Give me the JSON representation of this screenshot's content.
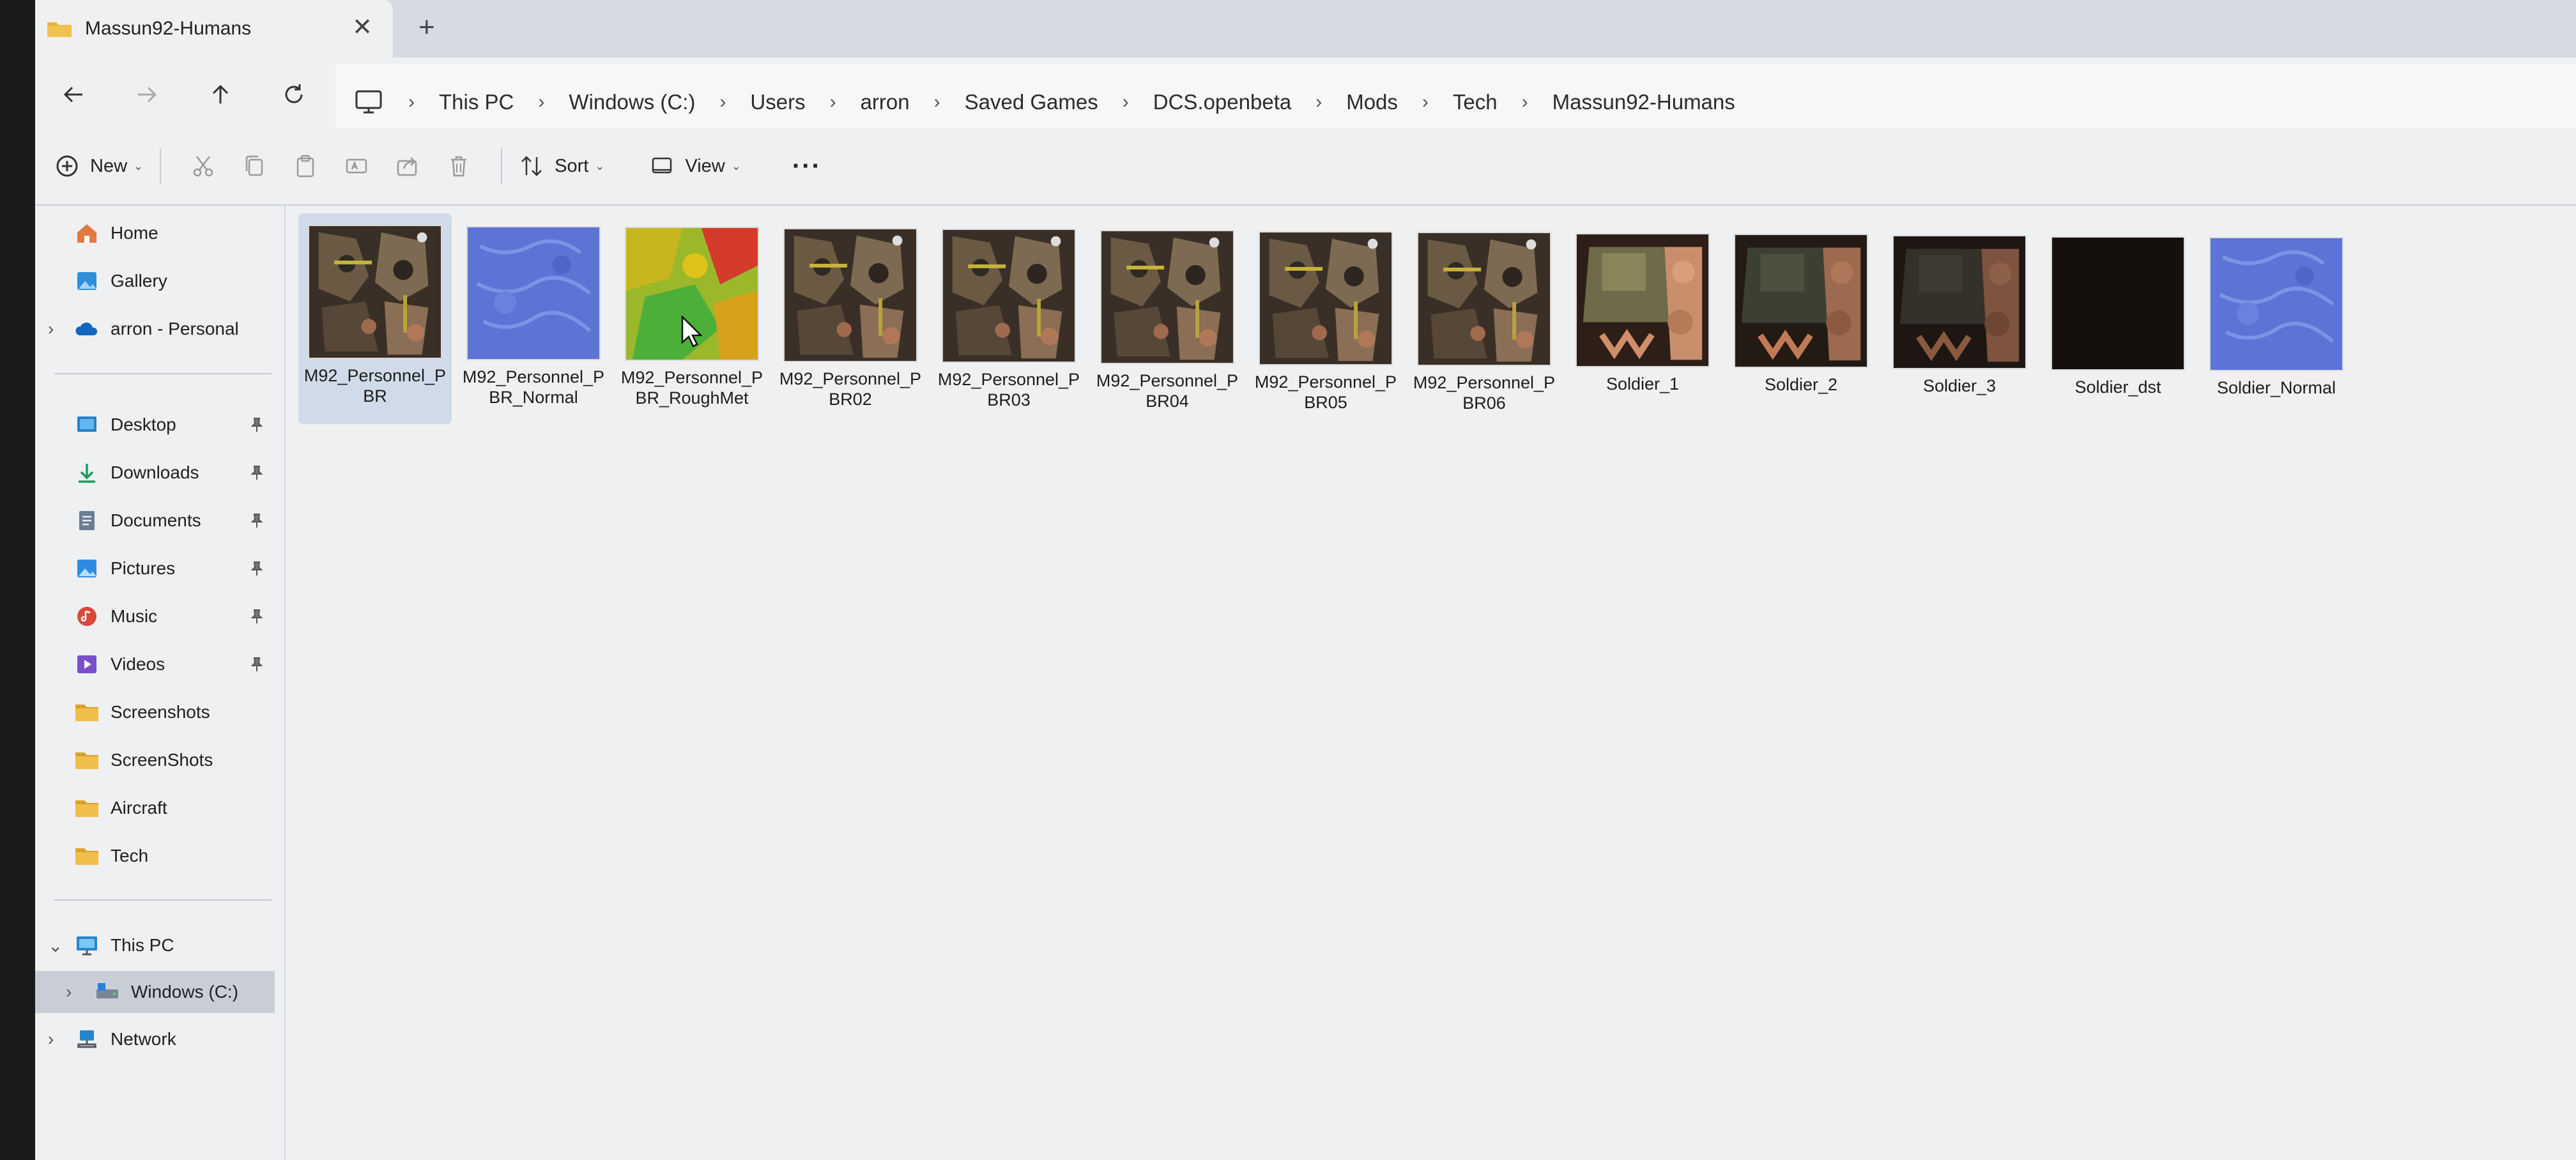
{
  "window": {
    "tab_title": "Massun92-Humans",
    "close_glyph": "✕",
    "new_tab_glyph": "+"
  },
  "address_bar": {
    "breadcrumbs": [
      "This PC",
      "Windows (C:)",
      "Users",
      "arron",
      "Saved Games",
      "DCS.openbeta",
      "Mods",
      "Tech",
      "Massun92-Humans"
    ],
    "separator": "›"
  },
  "toolbar": {
    "new_label": "New",
    "sort_label": "Sort",
    "view_label": "View",
    "more_label": "···",
    "caret": "⌄"
  },
  "sidebar": {
    "quick": [
      {
        "label": "Home",
        "icon": "home-icon"
      },
      {
        "label": "Gallery",
        "icon": "gallery-icon"
      },
      {
        "label": "arron - Personal",
        "icon": "onedrive-icon"
      }
    ],
    "pinned": [
      {
        "label": "Desktop",
        "icon": "desktop-icon"
      },
      {
        "label": "Downloads",
        "icon": "downloads-icon"
      },
      {
        "label": "Documents",
        "icon": "documents-icon"
      },
      {
        "label": "Pictures",
        "icon": "pictures-icon"
      },
      {
        "label": "Music",
        "icon": "music-icon"
      },
      {
        "label": "Videos",
        "icon": "videos-icon"
      }
    ],
    "folders": [
      "Screenshots",
      "ScreenShots",
      "Aircraft",
      "Tech"
    ],
    "this_pc": "This PC",
    "windows_c": "Windows (C:)",
    "network": "Network",
    "chevron_right": "›",
    "chevron_down": "⌄"
  },
  "files": [
    {
      "name": "M92_Personnel_PBR",
      "thumb": "camo"
    },
    {
      "name": "M92_Personnel_PBR_Normal",
      "thumb": "normal"
    },
    {
      "name": "M92_Personnel_PBR_RoughMet",
      "thumb": "roughmet"
    },
    {
      "name": "M92_Personnel_PBR02",
      "thumb": "camo"
    },
    {
      "name": "M92_Personnel_PBR03",
      "thumb": "camo"
    },
    {
      "name": "M92_Personnel_PBR04",
      "thumb": "camo"
    },
    {
      "name": "M92_Personnel_PBR05",
      "thumb": "camo"
    },
    {
      "name": "M92_Personnel_PBR06",
      "thumb": "camo"
    },
    {
      "name": "Soldier_1",
      "thumb": "soldier1"
    },
    {
      "name": "Soldier_2",
      "thumb": "soldier2"
    },
    {
      "name": "Soldier_3",
      "thumb": "soldier3"
    },
    {
      "name": "Soldier_dst",
      "thumb": "dark"
    },
    {
      "name": "Soldier_Normal",
      "thumb": "normal"
    }
  ],
  "colors": {
    "accent_folder": "#e8b43c",
    "selection": "#cfdbe8",
    "normal_map": "#5b74d6"
  }
}
